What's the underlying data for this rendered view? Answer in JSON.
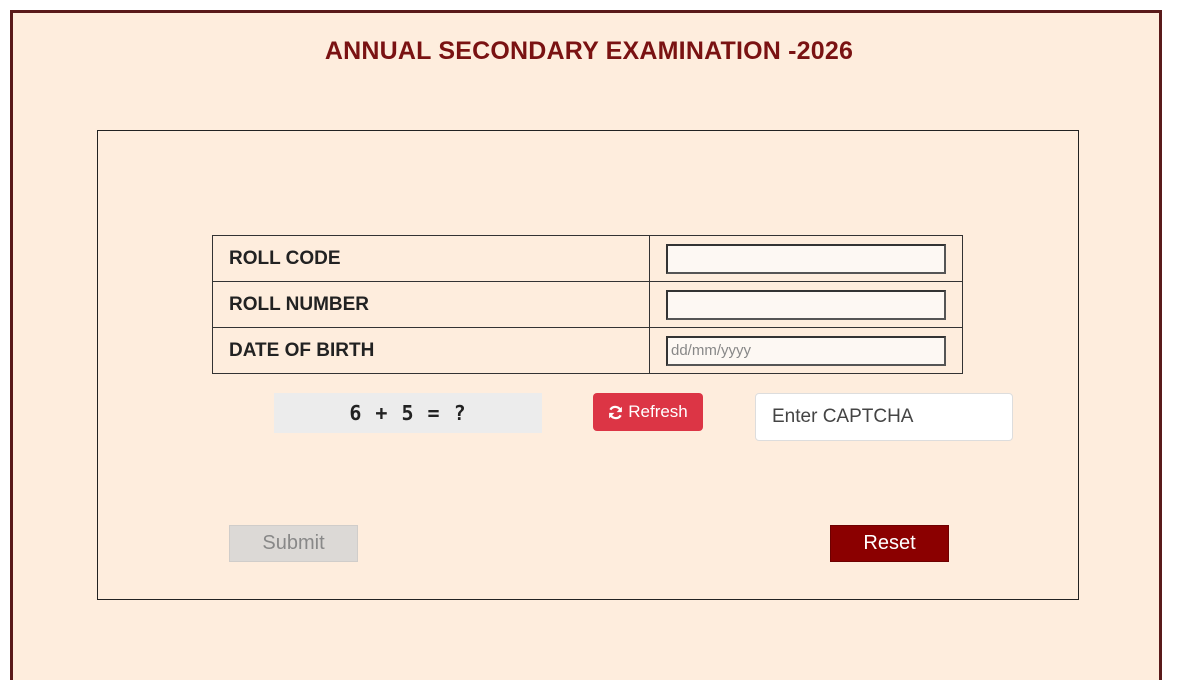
{
  "header": {
    "title": "ANNUAL SECONDARY EXAMINATION -2026"
  },
  "form": {
    "fields": [
      {
        "label": "ROLL CODE",
        "value": "",
        "placeholder": ""
      },
      {
        "label": "ROLL NUMBER",
        "value": "",
        "placeholder": ""
      },
      {
        "label": "DATE OF BIRTH",
        "value": "",
        "placeholder": "dd/mm/yyyy"
      }
    ],
    "captcha": {
      "question": "6 + 5 = ?",
      "refresh_label": "Refresh",
      "input_placeholder": "Enter CAPTCHA",
      "input_value": ""
    },
    "buttons": {
      "submit_label": "Submit",
      "reset_label": "Reset"
    }
  },
  "colors": {
    "page_background": "#feeddd",
    "title": "#7a1212",
    "refresh_button": "#dc3545",
    "reset_button": "#8b0000",
    "submit_disabled": "#dcd9d6"
  },
  "icons": {
    "refresh": "refresh-icon"
  }
}
